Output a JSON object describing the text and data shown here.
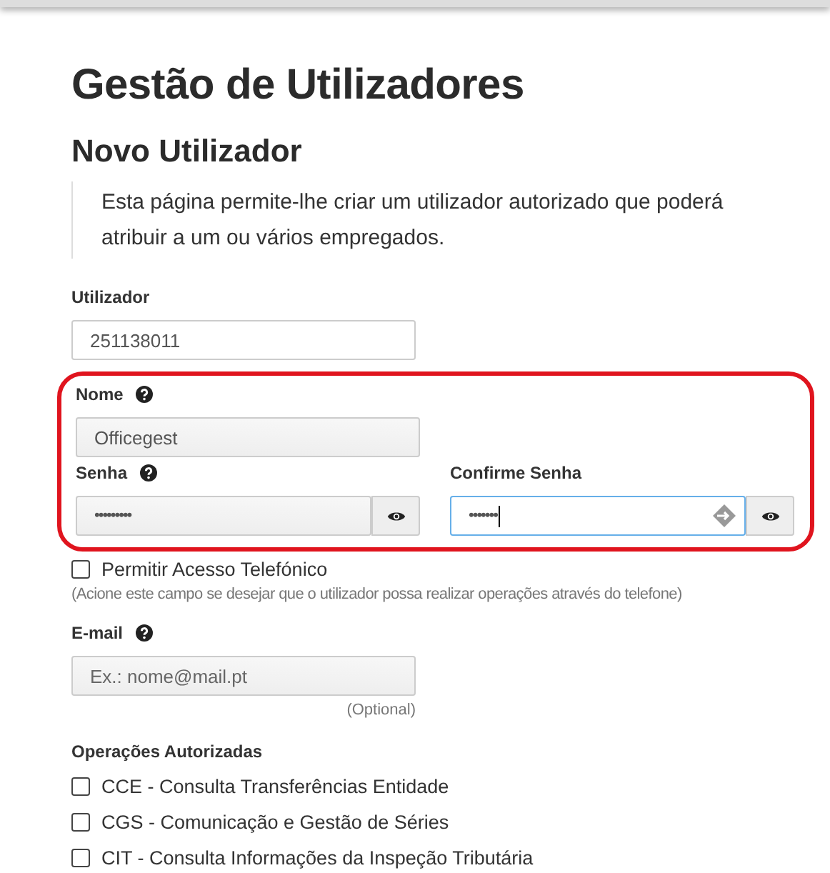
{
  "title": "Gestão de Utilizadores",
  "subtitle": "Novo Utilizador",
  "intro": "Esta página permite-lhe criar um utilizador autorizado que poderá atribuir a um ou vários empregados.",
  "user_field": {
    "label": "Utilizador",
    "value": "251138011"
  },
  "name_field": {
    "label": "Nome",
    "value": "Officegest",
    "help": true
  },
  "password_field": {
    "label": "Senha",
    "value": "•••••••••",
    "help": true
  },
  "confirm_field": {
    "label": "Confirme Senha",
    "value": "•••••••",
    "help": false,
    "focused": true
  },
  "phone_access": {
    "label": "Permitir Acesso Telefónico",
    "checked": false,
    "hint": "(Acione este campo se desejar que o utilizador possa realizar operações através do telefone)"
  },
  "email_field": {
    "label": "E-mail",
    "placeholder": "Ex.: nome@mail.pt",
    "help": true,
    "note": "(Optional)"
  },
  "operations": {
    "title": "Operações Autorizadas",
    "items": [
      {
        "label": "CCE - Consulta Transferências Entidade",
        "checked": false
      },
      {
        "label": "CGS - Comunicação e Gestão de Séries",
        "checked": false
      },
      {
        "label": "CIT - Consulta Informações da Inspeção Tributária",
        "checked": false
      }
    ]
  }
}
